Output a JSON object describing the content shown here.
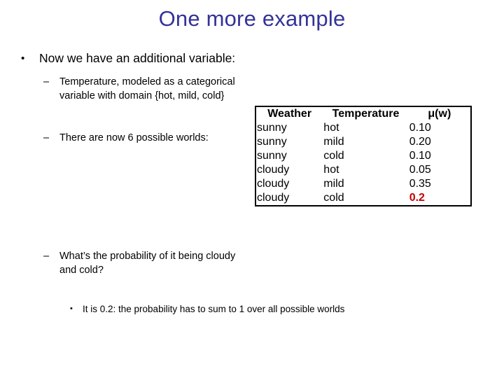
{
  "slide": {
    "title": "One more example",
    "title_color": "#333399",
    "bullets": [
      {
        "level": 1,
        "marker": "•",
        "text": "Now we have an additional variable:"
      },
      {
        "level": 2,
        "marker": "–",
        "text": "Temperature, modeled as a categorical variable with domain {hot, mild, cold}"
      },
      {
        "level": 2,
        "marker": "–",
        "text": "There are now 6 possible worlds:"
      },
      {
        "level": 2,
        "marker": "–",
        "text": "What’s the probability of it being cloudy and cold?"
      },
      {
        "level": 3,
        "marker": "•",
        "text": "It is 0.2: the probability has to sum to 1 over all possible worlds"
      }
    ]
  },
  "table": {
    "columns": [
      "Weather",
      "Temperature",
      "μ(w)"
    ],
    "rows": [
      {
        "weather": "sunny",
        "temperature": "hot",
        "mu": "0.10",
        "highlight": false
      },
      {
        "weather": "sunny",
        "temperature": "mild",
        "mu": "0.20",
        "highlight": false
      },
      {
        "weather": "sunny",
        "temperature": "cold",
        "mu": "0.10",
        "highlight": false
      },
      {
        "weather": "cloudy",
        "temperature": "hot",
        "mu": "0.05",
        "highlight": false
      },
      {
        "weather": "cloudy",
        "temperature": "mild",
        "mu": "0.35",
        "highlight": false
      },
      {
        "weather": "cloudy",
        "temperature": "cold",
        "mu": "0.2",
        "highlight": true
      }
    ],
    "highlight_color": "#C00000"
  }
}
